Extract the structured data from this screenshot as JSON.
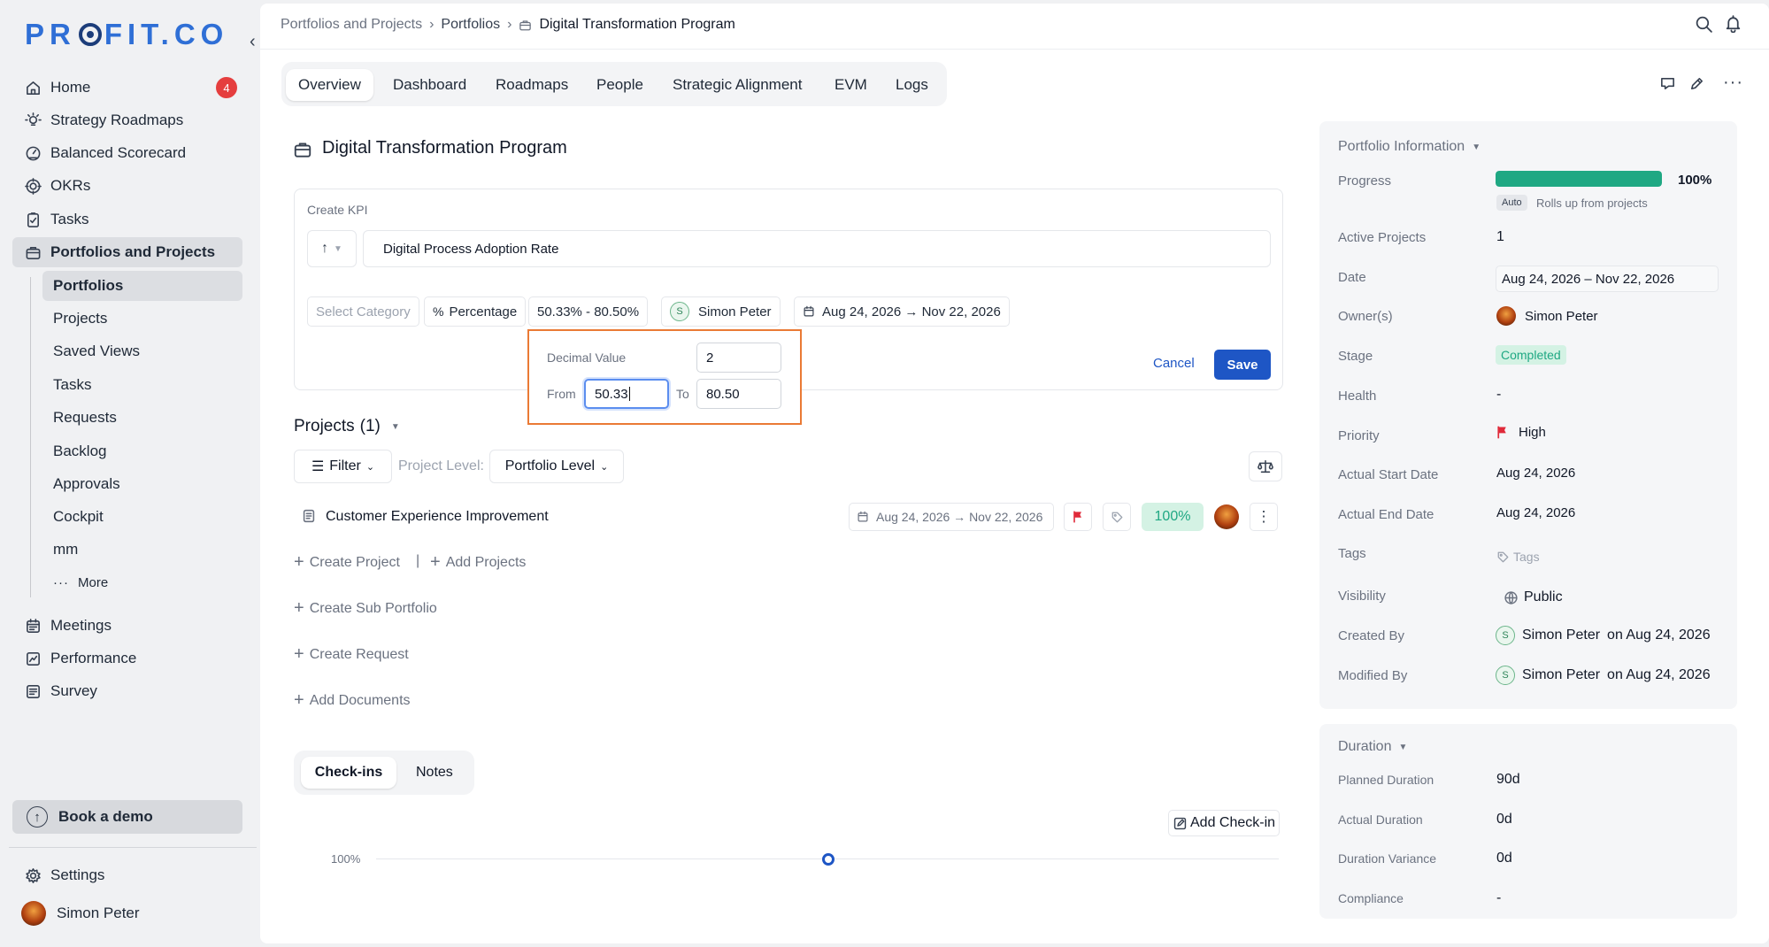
{
  "logo": {
    "pre": "PR",
    "post": "FIT.CO"
  },
  "sidebar": {
    "home": {
      "label": "Home",
      "badge": "4"
    },
    "items": [
      {
        "label": "Strategy Roadmaps"
      },
      {
        "label": "Balanced Scorecard"
      },
      {
        "label": "OKRs"
      },
      {
        "label": "Tasks"
      },
      {
        "label": "Portfolios and Projects"
      }
    ],
    "sub_items": [
      "Portfolios",
      "Projects",
      "Saved Views",
      "Tasks",
      "Requests",
      "Backlog",
      "Approvals",
      "Cockpit",
      "mm"
    ],
    "more": "More",
    "bottom_items": [
      "Meetings",
      "Performance",
      "Survey"
    ],
    "book_demo": "Book a demo",
    "settings": "Settings",
    "user": "Simon Peter"
  },
  "breadcrumb": [
    "Portfolios and Projects",
    "Portfolios",
    "Digital Transformation Program"
  ],
  "tabs": [
    "Overview",
    "Dashboard",
    "Roadmaps",
    "People",
    "Strategic Alignment",
    "EVM",
    "Logs"
  ],
  "page_title": "Digital Transformation Program",
  "kpi_form": {
    "heading": "Create KPI",
    "name_value": "Digital Process Adoption Rate",
    "category_placeholder": "Select Category",
    "unit": "Percentage",
    "unit_symbol": "%",
    "range": "50.33% - 80.50%",
    "owner": "Simon Peter",
    "owner_initial": "S",
    "dates": "Aug 24, 2026 → Nov 22, 2026",
    "cancel": "Cancel",
    "save": "Save",
    "popup": {
      "decimal_label": "Decimal Value",
      "decimal_value": "2",
      "from_label": "From",
      "from_value": "50.33",
      "to_label": "To",
      "to_value": "80.50"
    }
  },
  "projects": {
    "heading": "Projects",
    "count": "(1)",
    "filter": "Filter",
    "level_label": "Project Level:",
    "level_value": "Portfolio Level",
    "row": {
      "name": "Customer Experience Improvement",
      "dates": "Aug 24, 2026 → Nov 22, 2026",
      "progress": "100%"
    },
    "create_project": "Create Project",
    "add_projects": "Add Projects",
    "create_sub_portfolio": "Create Sub Portfolio",
    "create_request": "Create Request",
    "add_documents": "Add Documents"
  },
  "checkins": {
    "tabs": [
      "Check-ins",
      "Notes"
    ],
    "add": "Add Check-in",
    "axis_label": "100%"
  },
  "portfolio_info": {
    "heading": "Portfolio Information",
    "progress_label": "Progress",
    "progress_value": "100%",
    "progress_fraction": 1.0,
    "auto_tag": "Auto",
    "auto_note": "Rolls up from projects",
    "active_projects_label": "Active Projects",
    "active_projects": "1",
    "date_label": "Date",
    "date_value": "Aug 24, 2026 – Nov 22, 2026",
    "owners_label": "Owner(s)",
    "owner": "Simon Peter",
    "stage_label": "Stage",
    "stage": "Completed",
    "health_label": "Health",
    "health": "-",
    "priority_label": "Priority",
    "priority": "High",
    "start_label": "Actual Start Date",
    "start": "Aug 24, 2026",
    "end_label": "Actual End Date",
    "end": "Aug 24, 2026",
    "tags_label": "Tags",
    "tags_placeholder": "Tags",
    "visibility_label": "Visibility",
    "visibility": "Public",
    "created_label": "Created By",
    "created_by": "Simon Peter",
    "created_on": "on Aug 24, 2026",
    "modified_label": "Modified By",
    "modified_by": "Simon Peter",
    "modified_on": "on Aug 24, 2026",
    "user_initial": "S"
  },
  "duration": {
    "heading": "Duration",
    "planned_label": "Planned Duration",
    "planned": "90d",
    "actual_label": "Actual Duration",
    "actual": "0d",
    "variance_label": "Duration Variance",
    "variance": "0d",
    "compliance_label": "Compliance",
    "compliance": "-"
  },
  "colors": {
    "accent": "#1e56c5",
    "progress": "#1fa883",
    "completed_bg": "#d4f2e4",
    "priority_flag": "#e02a3a",
    "popup_border": "#ea7a35"
  }
}
